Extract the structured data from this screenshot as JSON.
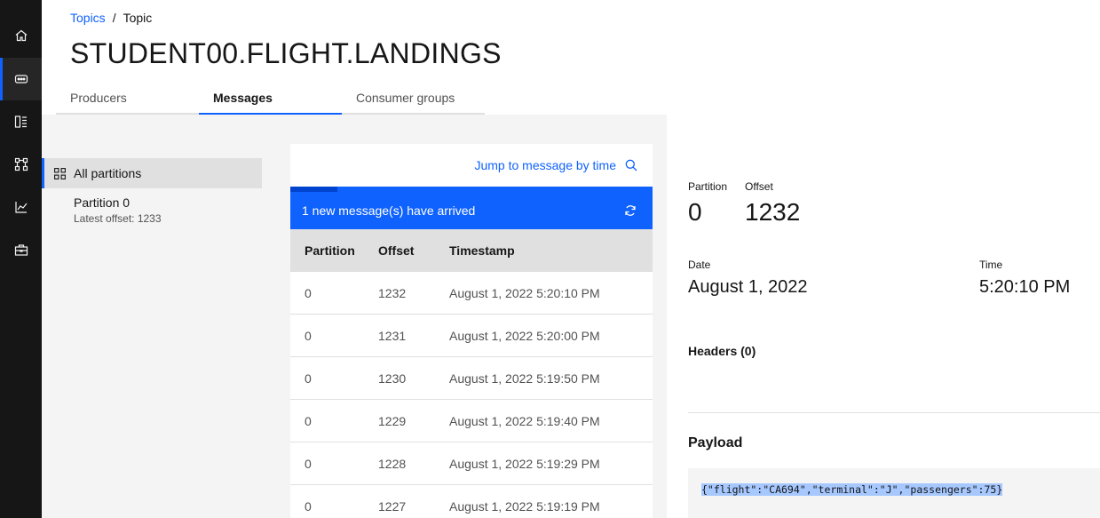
{
  "rail": {
    "items": [
      {
        "icon": "home-icon",
        "active": false
      },
      {
        "icon": "topics-icon",
        "active": true
      },
      {
        "icon": "schema-icon",
        "active": false
      },
      {
        "icon": "consumer-groups-icon",
        "active": false
      },
      {
        "icon": "monitoring-icon",
        "active": false
      },
      {
        "icon": "toolbox-icon",
        "active": false
      }
    ]
  },
  "breadcrumb": {
    "link": "Topics",
    "separator": "/",
    "current": "Topic"
  },
  "page_title": "STUDENT00.FLIGHT.LANDINGS",
  "tabs": [
    {
      "label": "Producers",
      "active": false
    },
    {
      "label": "Messages",
      "active": true
    },
    {
      "label": "Consumer groups",
      "active": false
    }
  ],
  "partitions": {
    "all_label": "All partitions",
    "items": [
      {
        "name": "Partition 0",
        "latest": "Latest offset: 1233"
      }
    ]
  },
  "messages": {
    "jump_label": "Jump to message by time",
    "banner": "1 new message(s) have arrived",
    "progress": 0.13,
    "columns": [
      "Partition",
      "Offset",
      "Timestamp"
    ],
    "rows": [
      {
        "partition": "0",
        "offset": "1232",
        "timestamp": "August 1, 2022 5:20:10 PM"
      },
      {
        "partition": "0",
        "offset": "1231",
        "timestamp": "August 1, 2022 5:20:00 PM"
      },
      {
        "partition": "0",
        "offset": "1230",
        "timestamp": "August 1, 2022 5:19:50 PM"
      },
      {
        "partition": "0",
        "offset": "1229",
        "timestamp": "August 1, 2022 5:19:40 PM"
      },
      {
        "partition": "0",
        "offset": "1228",
        "timestamp": "August 1, 2022 5:19:29 PM"
      },
      {
        "partition": "0",
        "offset": "1227",
        "timestamp": "August 1, 2022 5:19:19 PM"
      }
    ]
  },
  "detail": {
    "partition_label": "Partition",
    "partition_value": "0",
    "offset_label": "Offset",
    "offset_value": "1232",
    "date_label": "Date",
    "date_value": "August 1, 2022",
    "time_label": "Time",
    "time_value": "5:20:10 PM",
    "headers_title": "Headers (0)",
    "payload_title": "Payload",
    "payload": "{\"flight\":\"CA694\",\"terminal\":\"J\",\"passengers\":75}"
  },
  "colors": {
    "accent": "#0f62fe",
    "rail": "#161616",
    "selection": "#a6c8ff"
  }
}
